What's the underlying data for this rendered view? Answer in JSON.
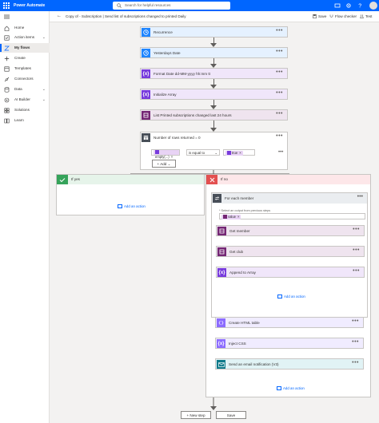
{
  "app": {
    "brand": "Power Automate",
    "search_placeholder": "Search for helpful resources"
  },
  "sidebar": {
    "items": [
      {
        "label": "Home",
        "icon": "home-icon"
      },
      {
        "label": "Action items",
        "icon": "checklist-icon",
        "chevron": "⌄"
      },
      {
        "label": "My flows",
        "icon": "flow-icon",
        "active": true
      },
      {
        "label": "Create",
        "icon": "plus-icon"
      },
      {
        "label": "Templates",
        "icon": "template-icon"
      },
      {
        "label": "Connectors",
        "icon": "connector-icon"
      },
      {
        "label": "Data",
        "icon": "database-icon",
        "chevron": "⌄"
      },
      {
        "label": "AI Builder",
        "icon": "ai-icon",
        "chevron": "⌄"
      },
      {
        "label": "Solutions",
        "icon": "solutions-icon"
      },
      {
        "label": "Learn",
        "icon": "book-icon"
      }
    ]
  },
  "toolbar": {
    "title": "Copy of - Subscription | Send list of subscriptions changed to printed Daily",
    "save_label": "Save",
    "flow_checker_label": "Flow checker",
    "test_label": "Test"
  },
  "steps": [
    {
      "label": "Recurrence",
      "color": "#1f85ff",
      "bg": "#e5f1ff",
      "icon": "clock-icon"
    },
    {
      "label": "Yesterdays Date",
      "color": "#1f85ff",
      "bg": "#e5f1ff",
      "icon": "clock-icon"
    },
    {
      "label": "Format Date dd-MM-yyyy hh:mm tt",
      "color": "#773adc",
      "bg": "#f0e6fa",
      "icon": "expression-icon"
    },
    {
      "label": "Initialize Array",
      "color": "#773adc",
      "bg": "#f0e6fa",
      "icon": "expression-icon"
    },
    {
      "label": "List Printed subscriptions changed last 24 hours",
      "color": "#742774",
      "bg": "#efe4ef",
      "icon": "dataverse-icon"
    }
  ],
  "condition": {
    "label": "Number of rows returned = 0",
    "left_chip": "empty(...)",
    "operator": "is equal to",
    "right_chip": "true",
    "add_label": "Add",
    "color": "#484f58"
  },
  "if_yes": {
    "label": "If yes",
    "add_action": "Add an action",
    "color": "#35a35a",
    "bg": "#e6f4ea"
  },
  "if_no": {
    "label": "If no",
    "color": "#e35050",
    "bg": "#fde7e9",
    "foreach": {
      "label": "For each member",
      "select_label": "* Select an output from previous steps",
      "chip": "value",
      "color": "#484f58",
      "steps": [
        {
          "label": "Get member",
          "color": "#742774",
          "bg": "#efe4ef",
          "icon": "dataverse-icon"
        },
        {
          "label": "Get club",
          "color": "#742774",
          "bg": "#efe4ef",
          "icon": "dataverse-icon"
        },
        {
          "label": "Append to Array",
          "color": "#773adc",
          "bg": "#f0e6fa",
          "icon": "expression-icon"
        }
      ],
      "add_action": "Add an action"
    },
    "after_steps": [
      {
        "label": "Create HTML table",
        "color": "#8c6cff",
        "bg": "#f0ecff",
        "icon": "table-icon"
      },
      {
        "label": "Inject CSS",
        "color": "#8c6cff",
        "bg": "#f0ecff",
        "icon": "expression-icon"
      },
      {
        "label": "Send an email notification (V3)",
        "color": "#0e7a8a",
        "bg": "#e1f3f5",
        "icon": "email-icon"
      }
    ],
    "add_action": "Add an action"
  },
  "footer": {
    "new_step_label": "+ New step",
    "save_label": "Save"
  },
  "more_glyph": "•••"
}
